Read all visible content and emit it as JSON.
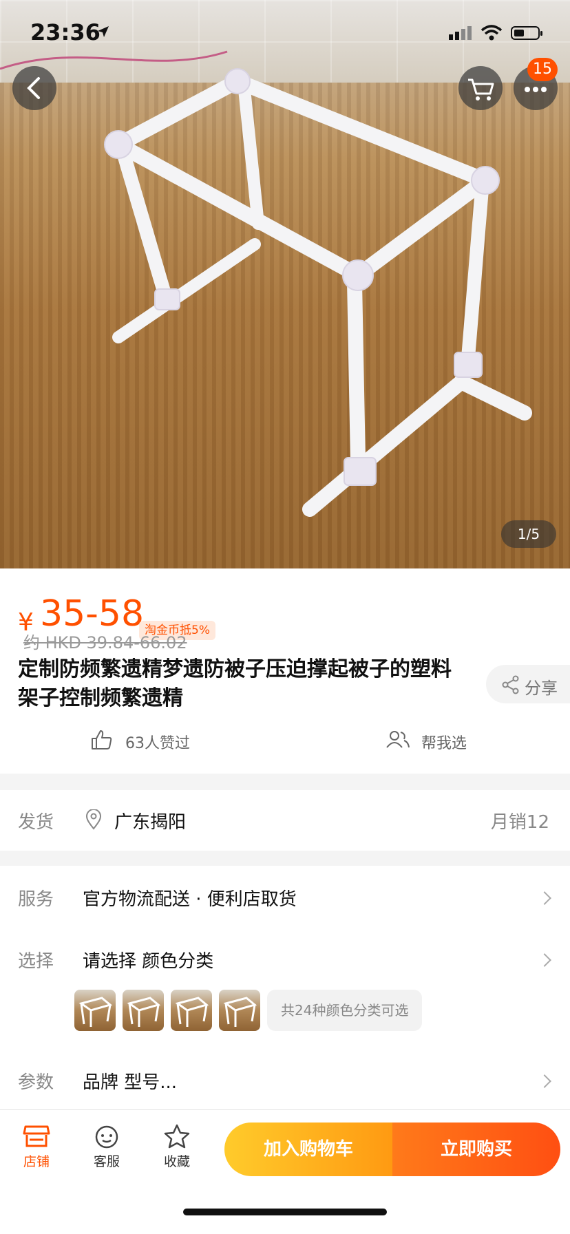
{
  "status_bar": {
    "time": "23:36"
  },
  "header": {
    "cart_badge": "15",
    "image_pager": "1/5"
  },
  "product": {
    "currency_symbol": "¥",
    "price_range": "35-58",
    "coin_tag": "淘金币抵5%",
    "hkd_price": "约 HKD 39.84-66.02",
    "title": "定制防频繁遗精梦遗防被子压迫撑起被子的塑料架子控制频繁遗精",
    "share_label": "分享",
    "likes_text": "63人赞过",
    "help_choose": "帮我选"
  },
  "shipping": {
    "label": "发货",
    "location": "广东揭阳",
    "monthly_sales": "月销12"
  },
  "service": {
    "label": "服务",
    "value": "官方物流配送 · 便利店取货"
  },
  "select": {
    "label": "选择",
    "value": "请选择 颜色分类",
    "more_colors": "共24种颜色分类可选"
  },
  "params": {
    "label": "参数",
    "value": "品牌 型号..."
  },
  "bottom_bar": {
    "shop": "店铺",
    "service": "客服",
    "favorite": "收藏",
    "add_to_cart": "加入购物车",
    "buy_now": "立即购买"
  },
  "colors": {
    "accent": "#ff5000",
    "cart_gradient": "#ffcb2b",
    "buy_gradient": "#ff4f12"
  }
}
